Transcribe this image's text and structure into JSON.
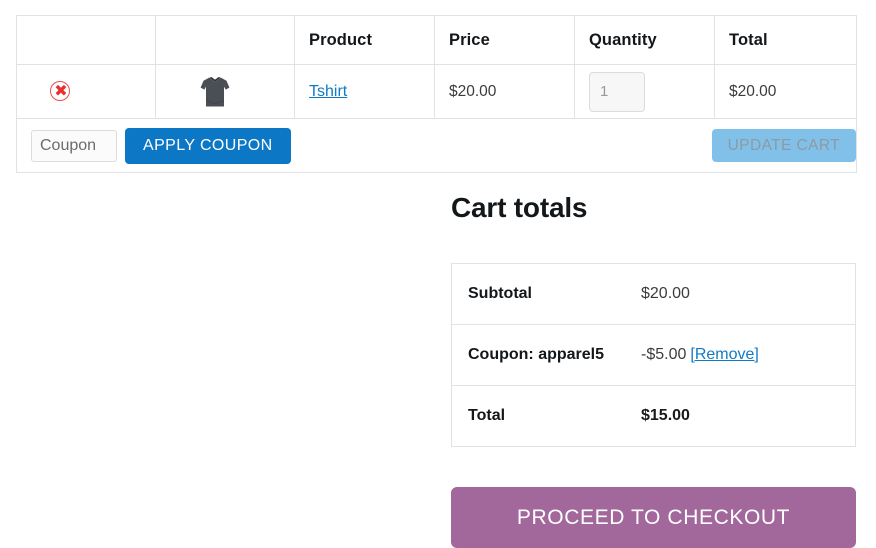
{
  "cart_table": {
    "headers": [
      {
        "label": "",
        "name": "remove"
      },
      {
        "label": "",
        "name": "thumbnail"
      },
      {
        "label": "Product",
        "name": "product"
      },
      {
        "label": "Price",
        "name": "price"
      },
      {
        "label": "Quantity",
        "name": "quantity"
      },
      {
        "label": "Total",
        "name": "total"
      }
    ],
    "rows": [
      {
        "remove_icon": "remove-circle-x-icon",
        "thumbnail_icon": "tshirt-thumbnail",
        "product_name": "Tshirt",
        "price": "$20.00",
        "quantity_value": "1",
        "line_total": "$20.00"
      }
    ],
    "actions": {
      "coupon_placeholder": "Coupon",
      "coupon_value": "",
      "apply_coupon_label": "Apply coupon",
      "update_cart_label": "Update cart",
      "update_cart_disabled": true
    }
  },
  "cart_totals": {
    "heading": "Cart totals",
    "rows": [
      {
        "label": "Subtotal",
        "value": "$20.00",
        "link": ""
      },
      {
        "label": "Coupon: apparel5",
        "value": "-$5.00",
        "link": "[Remove]"
      },
      {
        "label": "Total",
        "value": "$15.00",
        "link": ""
      }
    ],
    "checkout_label": "Proceed to checkout"
  },
  "colors": {
    "link": "#0f7bc4",
    "apply_button": "#0c77c4",
    "update_button_disabled": "#81c0e8",
    "checkout_button": "#a2689c",
    "remove_icon": "#e8302f",
    "border": "#e2e2e2",
    "tshirt": "#4a4f55"
  }
}
